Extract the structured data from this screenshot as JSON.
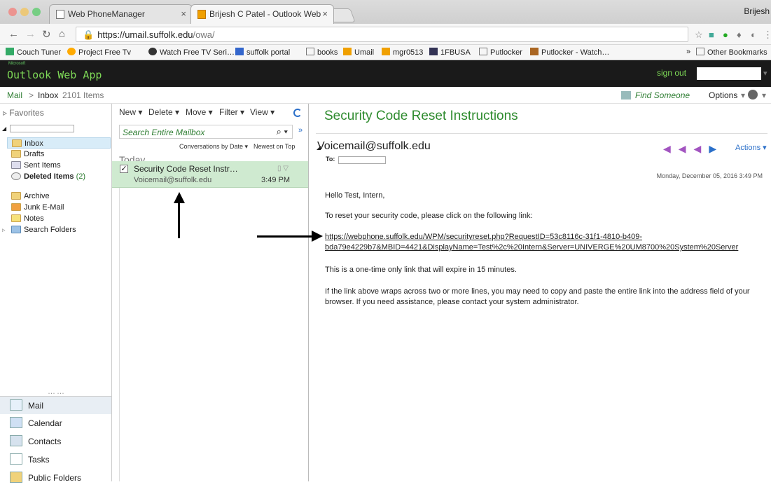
{
  "browser": {
    "tabs": [
      {
        "title": "Web PhoneManager",
        "close": "×"
      },
      {
        "title": "Brijesh C Patel - Outlook Web",
        "close": "×"
      }
    ],
    "user": "Brijesh",
    "url_host": "https://umail.suffolk.edu",
    "url_path": "/owa/",
    "bookmarks": [
      "Couch Tuner",
      "Project Free Tv",
      "Watch Free TV Seri…",
      "suffolk portal",
      "books",
      "Umail",
      "mgr0513",
      "1FBUSA",
      "Putlocker",
      "Putlocker - Watch…"
    ],
    "other_bookmarks": "Other Bookmarks"
  },
  "owa": {
    "logo_small": "Microsoft",
    "logo": "Outlook Web App",
    "sign_out": "sign out"
  },
  "crumb": {
    "mail": "Mail",
    "sep": ">",
    "inbox": "Inbox",
    "count": "2101 Items",
    "find": "Find Someone",
    "options": "Options"
  },
  "sidebar": {
    "favorites": "Favorites",
    "folders": [
      {
        "label": "Inbox",
        "count": ""
      },
      {
        "label": "Drafts",
        "count": ""
      },
      {
        "label": "Sent Items",
        "count": ""
      },
      {
        "label": "Deleted Items",
        "count": "(2)"
      },
      {
        "label": "Archive",
        "count": ""
      },
      {
        "label": "Junk E-Mail",
        "count": ""
      },
      {
        "label": "Notes",
        "count": ""
      },
      {
        "label": "Search Folders",
        "count": ""
      }
    ],
    "nav": [
      "Mail",
      "Calendar",
      "Contacts",
      "Tasks",
      "Public Folders"
    ]
  },
  "toolbar": {
    "new": "New",
    "delete": "Delete",
    "move": "Move",
    "filter": "Filter",
    "view": "View"
  },
  "list": {
    "search_placeholder": "Search Entire Mailbox",
    "sort_conv": "Conversations by Date",
    "sort_order": "Newest on Top",
    "group": "Today",
    "item": {
      "subject": "Security Code Reset Instr…",
      "from": "Voicemail@suffolk.edu",
      "time": "3:49 PM"
    }
  },
  "reading": {
    "title": "Security Code Reset Instructions",
    "from": "Voicemail@suffolk.edu",
    "to_label": "To:",
    "actions": "Actions",
    "date": "Monday, December 05, 2016 3:49 PM",
    "greeting": "Hello Test, Intern,",
    "line1": "To reset your security code, please click on the following link:",
    "link_line1": "https://webphone.suffolk.edu/WPM/securityreset.php?RequestID=53c8116c-31f1-4810-b409-",
    "link_line2": "bda79e4229b7&MBID=4421&DisplayName=Test%2c%20Intern&Server=UNIVERGE%20UM8700%20System%20Server",
    "line2": "This is a one-time only link that will expire in 15 minutes.",
    "line3": "If the link above wraps across two or more lines, you may need to copy and paste the entire link into the address field of your browser. If you need assistance, please contact your system administrator."
  }
}
